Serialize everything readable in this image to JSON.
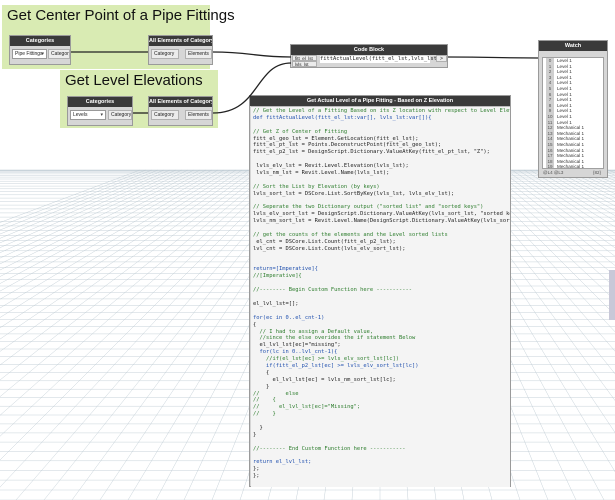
{
  "groups": {
    "center": {
      "title": "Get Center Point of a Pipe Fittings"
    },
    "levels": {
      "title": "Get Level Elevations"
    }
  },
  "nodes": {
    "categories1": {
      "title": "Categories",
      "selected": "Pipe Fittings",
      "output": "Category"
    },
    "all_elements1": {
      "title": "All Elements of Category",
      "input": "Category",
      "output": "Elements"
    },
    "categories2": {
      "title": "Categories",
      "selected": "Levels",
      "output": "Category"
    },
    "all_elements2": {
      "title": "All Elements of Category",
      "input": "Category",
      "output": "Elements"
    },
    "code_block": {
      "title": "Code Block",
      "inputs": [
        "fitt_el_lst",
        "lvls_lst"
      ],
      "code": "fittActualLevel(fitt_el_lst,lvls_lst);",
      "output": ">"
    },
    "watch": {
      "title": "Watch",
      "items": [
        {
          "idx": "0",
          "text": "Level 1"
        },
        {
          "idx": "1",
          "text": "Level 1"
        },
        {
          "idx": "2",
          "text": "Level 1"
        },
        {
          "idx": "3",
          "text": "Level 1"
        },
        {
          "idx": "4",
          "text": "Level 1"
        },
        {
          "idx": "5",
          "text": "Level 1"
        },
        {
          "idx": "6",
          "text": "Level 1"
        },
        {
          "idx": "7",
          "text": "Level 1"
        },
        {
          "idx": "8",
          "text": "Level 1"
        },
        {
          "idx": "9",
          "text": "Level 1"
        },
        {
          "idx": "10",
          "text": "Level 1"
        },
        {
          "idx": "11",
          "text": "Level 1"
        },
        {
          "idx": "12",
          "text": "Mechanical 1"
        },
        {
          "idx": "13",
          "text": "Mechanical 1"
        },
        {
          "idx": "14",
          "text": "Mechanical 1"
        },
        {
          "idx": "15",
          "text": "Mechanical 1"
        },
        {
          "idx": "16",
          "text": "Mechanical 1"
        },
        {
          "idx": "17",
          "text": "Mechanical 1"
        },
        {
          "idx": "18",
          "text": "Mechanical 1"
        },
        {
          "idx": "19",
          "text": "Mechanical 1"
        }
      ],
      "footer_left": "@L4 @L3",
      "footer_right": "{82}"
    },
    "custom": {
      "title": "Get Actual Level of a Pipe Fitting - Based on Z Elevation",
      "lines": [
        {
          "t": "// Get the Level of a Fitting Based on its Z location with respect to Level Elev",
          "c": "cmt"
        },
        {
          "t": "def fittActualLevel(fitt_el_lst:var[], lvls_lst:var[]){",
          "c": "blue"
        },
        {
          "t": "",
          "c": "dark"
        },
        {
          "t": "// Get Z of Center of Fitting",
          "c": "cmt"
        },
        {
          "t": "fitt_el_geo_lst = Element.GetLocation(fitt_el_lst);",
          "c": "dark"
        },
        {
          "t": "fitt_el_pt_lst = Points.DeconstructPoint(fitt_el_geo_lst);",
          "c": "dark"
        },
        {
          "t": "fitt_el_p2_lst = DesignScript.Dictionary.ValueAtKey(fitt_el_pt_lst, \"Z\");",
          "c": "dark"
        },
        {
          "t": "",
          "c": "dark"
        },
        {
          "t": " lvls_elv_lst = Revit.Level.Elevation(lvls_lst);",
          "c": "dark"
        },
        {
          "t": " lvls_nm_lst = Revit.Level.Name(lvls_lst);",
          "c": "dark"
        },
        {
          "t": "",
          "c": "dark"
        },
        {
          "t": "// Sort the List by Elevation (by keys)",
          "c": "cmt"
        },
        {
          "t": "lvls_sort_lst = DSCore.List.SortByKey(lvls_lst, lvls_elv_lst);",
          "c": "dark"
        },
        {
          "t": "",
          "c": "dark"
        },
        {
          "t": "// Seperate the two Dictionary output (\"sorted list\" and \"sorted keys\")",
          "c": "cmt"
        },
        {
          "t": "lvls_elv_sort_lst = DesignScript.Dictionary.ValueAtKey(lvls_sort_lst, \"sorted keys",
          "c": "dark"
        },
        {
          "t": "lvls_nm_sort_lst = Revit.Level.Name(DesignScript.Dictionary.ValueAtKey(lvls_sort_",
          "c": "dark"
        },
        {
          "t": "",
          "c": "dark"
        },
        {
          "t": "// get the counts of the elements and the Level sorted lists",
          "c": "cmt"
        },
        {
          "t": " el_cnt = DSCore.List.Count(fitt_el_p2_lst);",
          "c": "dark"
        },
        {
          "t": "lvl_cnt = DSCore.List.Count(lvls_elv_sort_lst);",
          "c": "dark"
        },
        {
          "t": "",
          "c": "dark"
        },
        {
          "t": "",
          "c": "dark"
        },
        {
          "t": "return=[Imperative]{",
          "c": "blue"
        },
        {
          "t": "//[Imperative]{",
          "c": "cmt"
        },
        {
          "t": "",
          "c": "dark"
        },
        {
          "t": "//-------- Begin Custom Function here -----------",
          "c": "cmt"
        },
        {
          "t": "",
          "c": "dark"
        },
        {
          "t": "el_lvl_lst=[];",
          "c": "dark"
        },
        {
          "t": "",
          "c": "dark"
        },
        {
          "t": "for(ec in 0..el_cnt-1)",
          "c": "blue"
        },
        {
          "t": "{",
          "c": "dark"
        },
        {
          "t": "  // I had to assign a Default value,",
          "c": "cmt"
        },
        {
          "t": "  //since the else overides the if statement Below",
          "c": "cmt"
        },
        {
          "t": "  el_lvl_lst[ec]=\"missing\";",
          "c": "dark"
        },
        {
          "t": "  for(lc in 0..lvl_cnt-1){",
          "c": "blue"
        },
        {
          "t": "    //if(el_lst[ec] >= lvls_elv_sort_lst[lc])",
          "c": "cmt"
        },
        {
          "t": "    if(fitt_el_p2_lst[ec] >= lvls_elv_sort_lst[lc])",
          "c": "blue"
        },
        {
          "t": "    {",
          "c": "dark"
        },
        {
          "t": "      el_lvl_lst[ec] = lvls_nm_sort_lst[lc];",
          "c": "dark"
        },
        {
          "t": "    }",
          "c": "dark"
        },
        {
          "t": "//        else",
          "c": "cmt"
        },
        {
          "t": "//    {",
          "c": "cmt"
        },
        {
          "t": "//      el_lvl_lst[ec]=\"Missing\";",
          "c": "cmt"
        },
        {
          "t": "//    }",
          "c": "cmt"
        },
        {
          "t": "",
          "c": "dark"
        },
        {
          "t": "  }",
          "c": "dark"
        },
        {
          "t": "}",
          "c": "dark"
        },
        {
          "t": "",
          "c": "dark"
        },
        {
          "t": "//-------- End Custom Function here -----------",
          "c": "cmt"
        },
        {
          "t": "",
          "c": "dark"
        },
        {
          "t": "return el_lvl_lst;",
          "c": "blue"
        },
        {
          "t": "};",
          "c": "dark"
        },
        {
          "t": "};",
          "c": "dark"
        }
      ]
    }
  },
  "colors": {
    "group_fill": "#d9ebb3",
    "node_header": "#3a3a3a",
    "wire": "#222222"
  }
}
